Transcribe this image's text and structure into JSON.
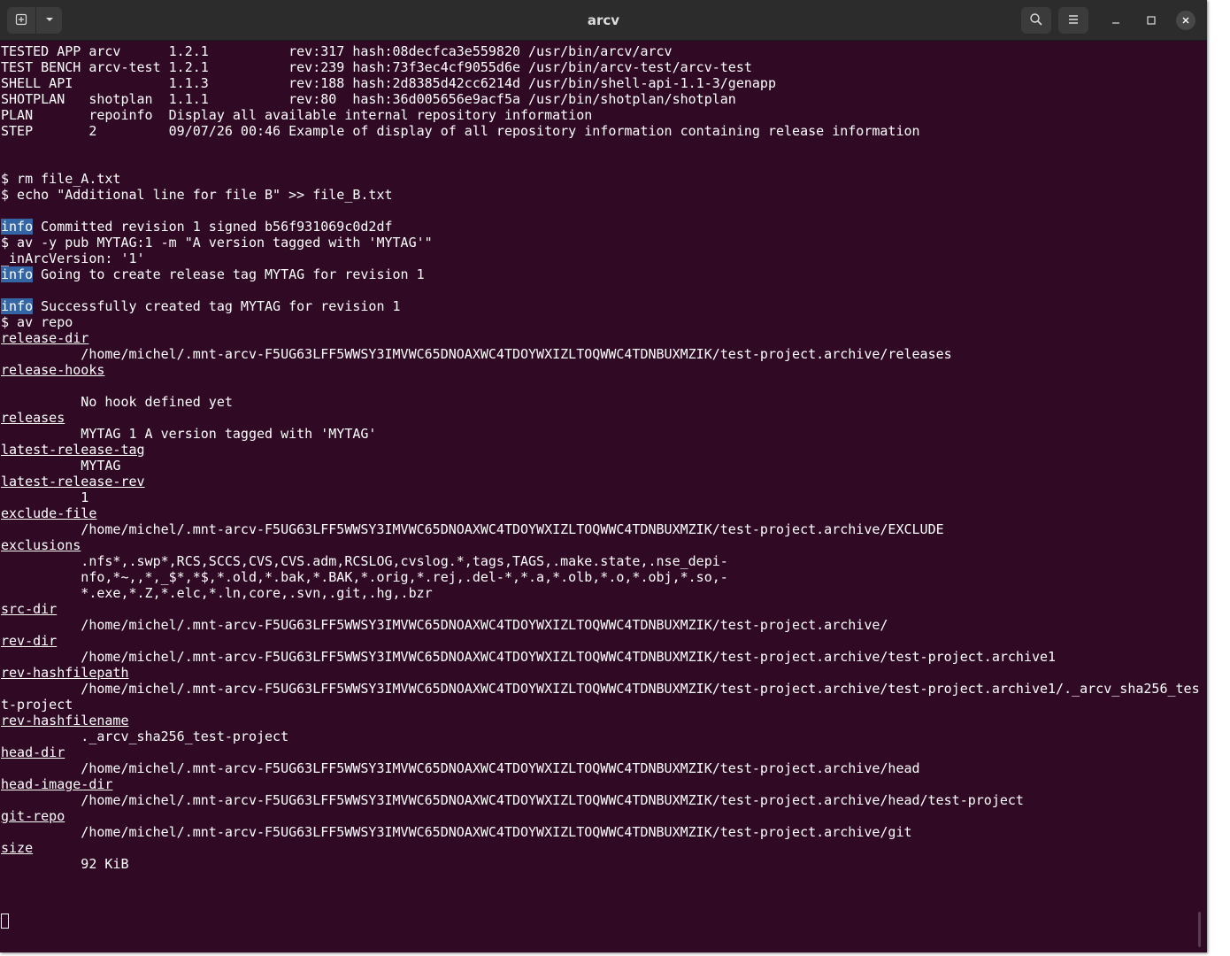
{
  "window": {
    "title": "arcv"
  },
  "icons": {
    "new_tab": "new-tab-icon",
    "dropdown": "chevron-down-icon",
    "search": "search-icon",
    "menu": "hamburger-menu-icon",
    "minimize": "minimize-icon",
    "maximize": "maximize-icon",
    "close": "close-icon"
  },
  "colors": {
    "terminal_bg": "#300a24",
    "headerbar_bg": "#2c2c2c",
    "info_highlight": "#3465a4"
  },
  "terminal": {
    "lines": [
      "TESTED APP arcv      1.2.1          rev:317 hash:08decfca3e559820 /usr/bin/arcv/arcv",
      "TEST BENCH arcv-test 1.2.1          rev:239 hash:73f3ec4cf9055d6e /usr/bin/arcv-test/arcv-test",
      "SHELL API            1.1.3          rev:188 hash:2d8385d42cc6214d /usr/bin/shell-api-1.1-3/genapp",
      "SHOTPLAN   shotplan  1.1.1          rev:80  hash:36d005656e9acf5a /usr/bin/shotplan/shotplan",
      "PLAN       repoinfo  Display all available internal repository information",
      "STEP       2         09/07/26 00:46 Example of display of all repository information containing release information",
      "",
      "",
      "$ rm file_A.txt",
      "$ echo \"Additional line for file B\" >> file_B.txt",
      "",
      "Committed revision 1 signed b56f931069c0d2df",
      "$ av -y pub MYTAG:1 -m \"A version tagged with 'MYTAG'\"",
      "_inArcVersion: '1'",
      "Going to create release tag MYTAG for revision 1",
      "",
      "Successfully created tag MYTAG for revision 1",
      "$ av repo",
      "release-dir",
      "          /home/michel/.mnt-arcv-F5UG63LFF5WWSY3IMVWC65DNOAXWC4TDOYWXIZLTOQWWC4TDNBUXMZIK/test-project.archive/releases",
      "release-hooks",
      "",
      "          No hook defined yet",
      "releases",
      "          MYTAG 1 A version tagged with 'MYTAG'",
      "latest-release-tag",
      "          MYTAG",
      "latest-release-rev",
      "          1",
      "exclude-file",
      "          /home/michel/.mnt-arcv-F5UG63LFF5WWSY3IMVWC65DNOAXWC4TDOYWXIZLTOQWWC4TDNBUXMZIK/test-project.archive/EXCLUDE",
      "exclusions",
      "          .nfs*,.swp*,RCS,SCCS,CVS,CVS.adm,RCSLOG,cvslog.*,tags,TAGS,.make.state,.nse_depi-",
      "          nfo,*~,,*,_$*,*$,*.old,*.bak,*.BAK,*.orig,*.rej,.del-*,*.a,*.olb,*.o,*.obj,*.so,-",
      "          *.exe,*.Z,*.elc,*.ln,core,.svn,.git,.hg,.bzr",
      "src-dir",
      "          /home/michel/.mnt-arcv-F5UG63LFF5WWSY3IMVWC65DNOAXWC4TDOYWXIZLTOQWWC4TDNBUXMZIK/test-project.archive/",
      "rev-dir",
      "          /home/michel/.mnt-arcv-F5UG63LFF5WWSY3IMVWC65DNOAXWC4TDOYWXIZLTOQWWC4TDNBUXMZIK/test-project.archive/test-project.archive1",
      "rev-hashfilepath",
      "          /home/michel/.mnt-arcv-F5UG63LFF5WWSY3IMVWC65DNOAXWC4TDOYWXIZLTOQWWC4TDNBUXMZIK/test-project.archive/test-project.archive1/._arcv_sha256_tes",
      "t-project",
      "rev-hashfilename",
      "          ._arcv_sha256_test-project",
      "head-dir",
      "          /home/michel/.mnt-arcv-F5UG63LFF5WWSY3IMVWC65DNOAXWC4TDOYWXIZLTOQWWC4TDNBUXMZIK/test-project.archive/head",
      "head-image-dir",
      "          /home/michel/.mnt-arcv-F5UG63LFF5WWSY3IMVWC65DNOAXWC4TDOYWXIZLTOQWWC4TDNBUXMZIK/test-project.archive/head/test-project",
      "git-repo",
      "          /home/michel/.mnt-arcv-F5UG63LFF5WWSY3IMVWC65DNOAXWC4TDOYWXIZLTOQWWC4TDNBUXMZIK/test-project.archive/git",
      "size",
      "          92 KiB"
    ],
    "info_badge": "info"
  }
}
